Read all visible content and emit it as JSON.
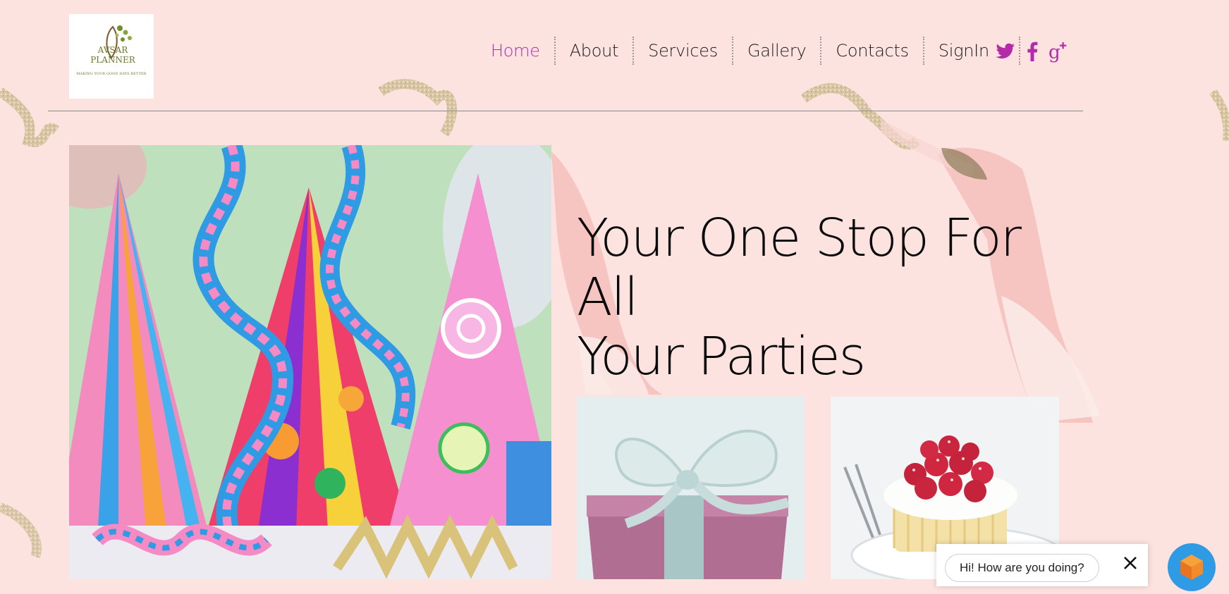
{
  "brand": {
    "logo_line1": "AVSAR",
    "logo_line2": "PLANNER",
    "logo_tagline": "MAKING YOUR GOOD DAYS BETTER"
  },
  "nav": {
    "items": [
      {
        "label": "Home",
        "active": true
      },
      {
        "label": "About",
        "active": false
      },
      {
        "label": "Services",
        "active": false
      },
      {
        "label": "Gallery",
        "active": false
      },
      {
        "label": "Contacts",
        "active": false
      },
      {
        "label": "SignIn",
        "active": false
      }
    ]
  },
  "social": {
    "icons": [
      "twitter-icon",
      "facebook-icon",
      "google-plus-icon"
    ],
    "color": "#b52aa9"
  },
  "hero": {
    "headline_line1": "Your One Stop For All",
    "headline_line2": "Your Parties"
  },
  "chat": {
    "greeting": "Hi! How are you doing?"
  },
  "colors": {
    "background": "#fde3df",
    "accent": "#b52aa9",
    "chat_launcher": "#2f9be5"
  }
}
